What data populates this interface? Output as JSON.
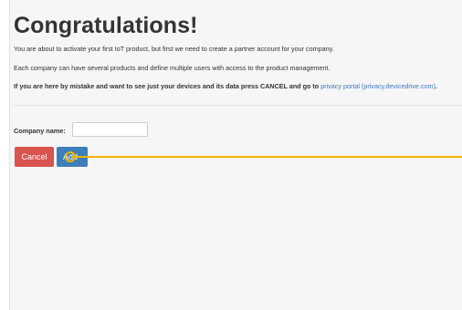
{
  "page": {
    "title": "Congratulations!",
    "paragraph_1": "You are about to activate your first IoT product, but first we need to create a partner account for your company.",
    "paragraph_2": "Each company can have several products and define multiple users with access to the product management.",
    "paragraph_3_text": "If you are here by mistake and want to see just your devices and its data press CANCEL and go to ",
    "paragraph_3_link": "privacy portal (privacy.devicedrive.com)",
    "paragraph_3_end": "."
  },
  "form": {
    "company_label": "Company name:",
    "company_value": "",
    "company_placeholder": ""
  },
  "buttons": {
    "cancel_label": "Cancel",
    "add_label": "Add"
  },
  "colors": {
    "cancel": "#d9534f",
    "add": "#3f7fb9",
    "link": "#3a79c4",
    "pointer": "#f0b400"
  }
}
